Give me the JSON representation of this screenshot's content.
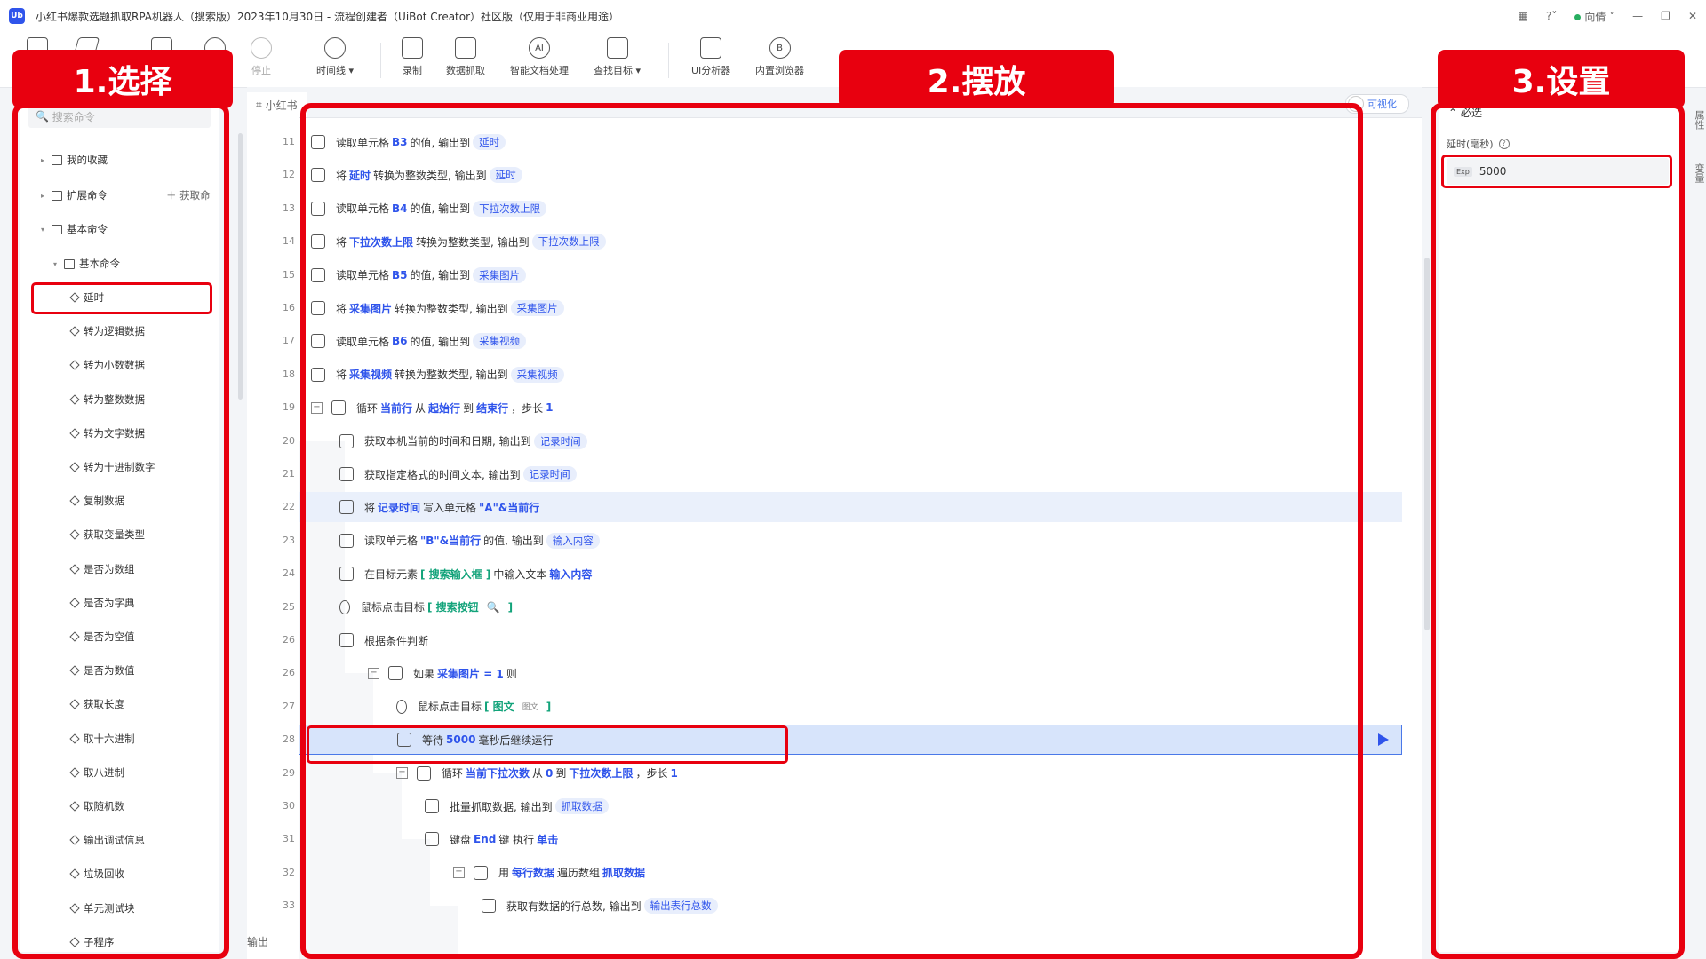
{
  "window": {
    "title": "小红书爆款选题抓取RPA机器人（搜索版）2023年10月30日 - 流程创建者（UiBot Creator）社区版（仅用于非商业用途）",
    "user": "向倩",
    "app_logo": "Ub"
  },
  "toolbar": [
    {
      "label": "停止",
      "icon": "stop-icon"
    },
    {
      "label": "时间线 ▾",
      "icon": "clock-icon"
    },
    {
      "label": "录制",
      "icon": "record-icon"
    },
    {
      "label": "数据抓取",
      "icon": "data-grab-icon"
    },
    {
      "label": "智能文档处理",
      "icon": "ai-doc-icon"
    },
    {
      "label": "查找目标 ▾",
      "icon": "find-target-icon"
    },
    {
      "label": "UI分析器",
      "icon": "ui-analyzer-icon"
    },
    {
      "label": "内置浏览器",
      "icon": "browser-icon"
    }
  ],
  "callouts": {
    "select": "1.选择",
    "place": "2.摆放",
    "settings": "3.设置"
  },
  "sidebar": {
    "search_placeholder": "搜索命令",
    "groups": [
      {
        "label": "我的收藏"
      },
      {
        "label": "扩展命令",
        "action": "获取命"
      },
      {
        "label": "基本命令"
      },
      {
        "label": "基本命令"
      }
    ],
    "items": [
      "延时",
      "转为逻辑数据",
      "转为小数数据",
      "转为整数数据",
      "转为文字数据",
      "转为十进制数字",
      "复制数据",
      "获取变量类型",
      "是否为数组",
      "是否为字典",
      "是否为空值",
      "是否为数值",
      "获取长度",
      "取十六进制",
      "取八进制",
      "取随机数",
      "输出调试信息",
      "垃圾回收",
      "单元测试块",
      "子程序"
    ]
  },
  "editor": {
    "tab_label": "小红书",
    "toggle_label": "可视化",
    "output_label": "输出"
  },
  "code_rows": [
    {
      "n": "11",
      "parts": [
        [
          "t",
          "读取单元格"
        ],
        [
          "k",
          "B3"
        ],
        [
          "t",
          "的值, 输出到"
        ],
        [
          "v",
          "延时"
        ]
      ]
    },
    {
      "n": "12",
      "parts": [
        [
          "t",
          "将"
        ],
        [
          "k",
          "延时"
        ],
        [
          "t",
          "转换为整数类型, 输出到"
        ],
        [
          "v",
          "延时"
        ]
      ]
    },
    {
      "n": "13",
      "parts": [
        [
          "t",
          "读取单元格"
        ],
        [
          "k",
          "B4"
        ],
        [
          "t",
          "的值, 输出到"
        ],
        [
          "v",
          "下拉次数上限"
        ]
      ]
    },
    {
      "n": "14",
      "parts": [
        [
          "t",
          "将"
        ],
        [
          "k",
          "下拉次数上限"
        ],
        [
          "t",
          "转换为整数类型, 输出到"
        ],
        [
          "v",
          "下拉次数上限"
        ]
      ]
    },
    {
      "n": "15",
      "parts": [
        [
          "t",
          "读取单元格"
        ],
        [
          "k",
          "B5"
        ],
        [
          "t",
          "的值, 输出到"
        ],
        [
          "v",
          "采集图片"
        ]
      ]
    },
    {
      "n": "16",
      "parts": [
        [
          "t",
          "将"
        ],
        [
          "k",
          "采集图片"
        ],
        [
          "t",
          "转换为整数类型, 输出到"
        ],
        [
          "v",
          "采集图片"
        ]
      ]
    },
    {
      "n": "17",
      "parts": [
        [
          "t",
          "读取单元格"
        ],
        [
          "k",
          "B6"
        ],
        [
          "t",
          "的值, 输出到"
        ],
        [
          "v",
          "采集视频"
        ]
      ]
    },
    {
      "n": "18",
      "parts": [
        [
          "t",
          "将"
        ],
        [
          "k",
          "采集视频"
        ],
        [
          "t",
          "转换为整数类型, 输出到"
        ],
        [
          "v",
          "采集视频"
        ]
      ]
    },
    {
      "n": "19",
      "parts": [
        [
          "t",
          "循环"
        ],
        [
          "k",
          "当前行"
        ],
        [
          "t",
          "从"
        ],
        [
          "k",
          "起始行"
        ],
        [
          "t",
          "到"
        ],
        [
          "k",
          "结束行"
        ],
        [
          "t",
          "，步长"
        ],
        [
          "k",
          "1"
        ]
      ]
    },
    {
      "n": "20",
      "parts": [
        [
          "t",
          "获取本机当前的时间和日期, 输出到"
        ],
        [
          "v",
          "记录时间"
        ]
      ]
    },
    {
      "n": "21",
      "parts": [
        [
          "t",
          "获取指定格式的时间文本, 输出到"
        ],
        [
          "v",
          "记录时间"
        ]
      ]
    },
    {
      "n": "22",
      "parts": [
        [
          "t",
          "将"
        ],
        [
          "k",
          "记录时间"
        ],
        [
          "t",
          "写入单元格"
        ],
        [
          "k",
          "\"A\"&当前行"
        ]
      ]
    },
    {
      "n": "23",
      "parts": [
        [
          "t",
          "读取单元格"
        ],
        [
          "k",
          "\"B\"&当前行"
        ],
        [
          "t",
          "的值, 输出到"
        ],
        [
          "v",
          "输入内容"
        ]
      ]
    },
    {
      "n": "24",
      "parts": [
        [
          "t",
          "在目标元素"
        ],
        [
          "g",
          "[ 搜索输入框        ]"
        ],
        [
          "t",
          "中输入文本"
        ],
        [
          "k",
          "输入内容"
        ]
      ]
    },
    {
      "n": "25",
      "parts": [
        [
          "t",
          "鼠标点击目标"
        ],
        [
          "g",
          "[ 搜索按钮"
        ],
        [
          "s",
          "search"
        ],
        [
          "g",
          "]"
        ]
      ]
    },
    {
      "n": "26",
      "parts": [
        [
          "t",
          "根据条件判断"
        ]
      ]
    },
    {
      "n": "26",
      "parts": [
        [
          "t",
          "如果"
        ],
        [
          "k",
          "采集图片 = 1"
        ],
        [
          "t",
          "则"
        ]
      ]
    },
    {
      "n": "27",
      "parts": [
        [
          "t",
          "鼠标点击目标"
        ],
        [
          "g",
          "[ 图文"
        ],
        [
          "x",
          "图文"
        ],
        [
          "g",
          "]"
        ]
      ]
    },
    {
      "n": "28",
      "parts": [
        [
          "t",
          "等待"
        ],
        [
          "k",
          "5000"
        ],
        [
          "t",
          "毫秒后继续运行"
        ]
      ]
    },
    {
      "n": "29",
      "parts": [
        [
          "t",
          "循环"
        ],
        [
          "k",
          "当前下拉次数"
        ],
        [
          "t",
          "从"
        ],
        [
          "k",
          "0"
        ],
        [
          "t",
          "到"
        ],
        [
          "k",
          "下拉次数上限"
        ],
        [
          "t",
          "，步长"
        ],
        [
          "k",
          "1"
        ]
      ]
    },
    {
      "n": "30",
      "parts": [
        [
          "t",
          "批量抓取数据, 输出到"
        ],
        [
          "v",
          "抓取数据"
        ]
      ]
    },
    {
      "n": "31",
      "parts": [
        [
          "t",
          "键盘"
        ],
        [
          "k",
          "End"
        ],
        [
          "t",
          "键 执行"
        ],
        [
          "k",
          "单击"
        ]
      ]
    },
    {
      "n": "32",
      "parts": [
        [
          "t",
          "用"
        ],
        [
          "k",
          "每行数据"
        ],
        [
          "t",
          "遍历数组"
        ],
        [
          "k",
          "抓取数据"
        ]
      ]
    },
    {
      "n": "33",
      "parts": [
        [
          "t",
          "获取有数据的行总数, 输出到"
        ],
        [
          "v",
          "输出表行总数"
        ]
      ]
    }
  ],
  "props": {
    "section": "必选",
    "delay_label": "延时(毫秒)",
    "exp_tag": "Exp",
    "delay_value": "5000"
  },
  "right_strip": [
    "属性",
    "变量"
  ]
}
